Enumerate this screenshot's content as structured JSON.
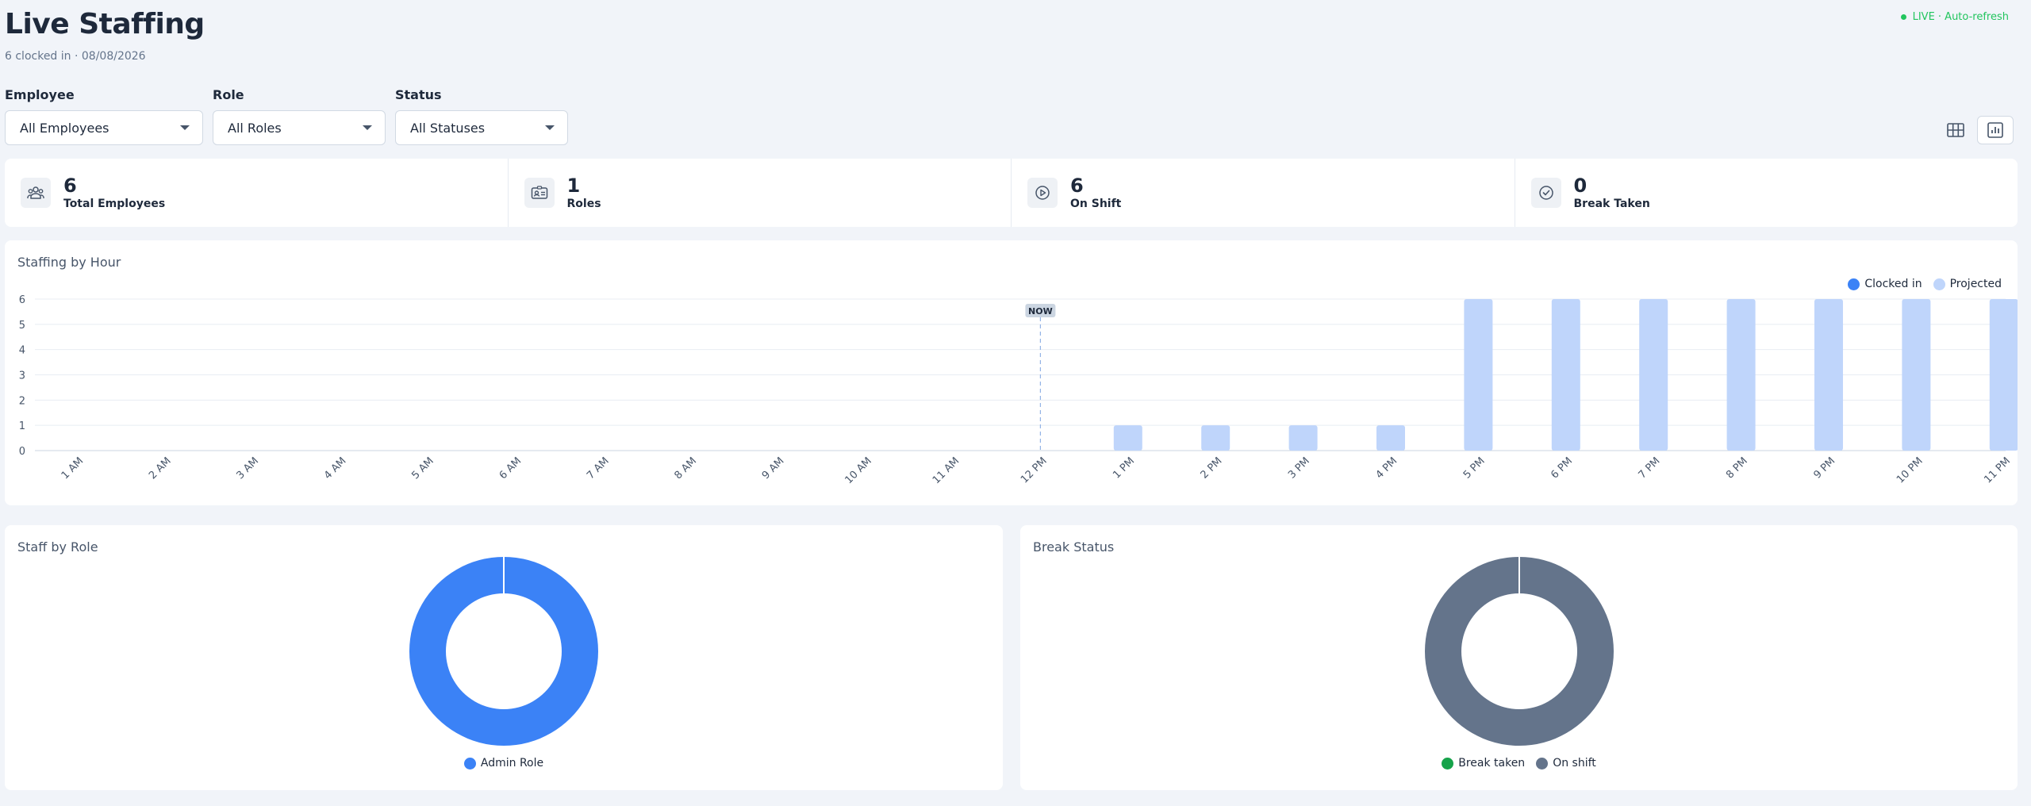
{
  "header": {
    "title": "Live Staffing",
    "subtitle": "6 clocked in · 08/08/2026",
    "live_label": "LIVE · Auto-refresh"
  },
  "filters": [
    {
      "label": "Employee",
      "value": "All Employees"
    },
    {
      "label": "Role",
      "value": "All Roles"
    },
    {
      "label": "Status",
      "value": "All Statuses"
    }
  ],
  "view_toggle": {
    "active": "chart-view",
    "icons": [
      "grid-view-icon",
      "chart-view-icon"
    ]
  },
  "stats": [
    {
      "value": "6",
      "label": "Total Employees",
      "icon": "users-icon"
    },
    {
      "value": "1",
      "label": "Roles",
      "icon": "id-card-icon"
    },
    {
      "value": "6",
      "label": "On Shift",
      "icon": "play-circle-icon"
    },
    {
      "value": "0",
      "label": "Break Taken",
      "icon": "check-circle-icon"
    }
  ],
  "staffing_by_hour": {
    "title": "Staffing by Hour",
    "now_label": "NOW"
  },
  "staff_by_role": {
    "title": "Staff by Role"
  },
  "break_status": {
    "title": "Break Status"
  },
  "colors": {
    "clocked_in": "#3b82f6",
    "projected": "#bfd5fb",
    "admin_role": "#3b82f6",
    "break_taken": "#16a34a",
    "on_shift": "#64748b",
    "live": "#22c55e"
  },
  "chart_data": [
    {
      "type": "bar",
      "title": "Staffing by Hour",
      "categories": [
        "1 AM",
        "2 AM",
        "3 AM",
        "4 AM",
        "5 AM",
        "6 AM",
        "7 AM",
        "8 AM",
        "9 AM",
        "10 AM",
        "11 AM",
        "12 PM",
        "1 PM",
        "2 PM",
        "3 PM",
        "4 PM",
        "5 PM",
        "6 PM",
        "7 PM",
        "8 PM",
        "9 PM",
        "10 PM",
        "11 PM"
      ],
      "series": [
        {
          "name": "Clocked in",
          "values": [
            0,
            0,
            0,
            0,
            0,
            0,
            0,
            0,
            0,
            0,
            0,
            0,
            0,
            0,
            0,
            0,
            0,
            0,
            0,
            0,
            0,
            0,
            0
          ]
        },
        {
          "name": "Projected",
          "values": [
            0,
            0,
            0,
            0,
            0,
            0,
            0,
            0,
            0,
            0,
            0,
            0,
            1,
            1,
            1,
            1,
            6,
            6,
            6,
            6,
            6,
            6,
            6
          ]
        }
      ],
      "ylim": [
        0,
        6
      ],
      "yticks": [
        0,
        1,
        2,
        3,
        4,
        5,
        6
      ],
      "now_category": "12 PM",
      "grid": true,
      "legend": "top-right"
    },
    {
      "type": "pie",
      "title": "Staff by Role",
      "labels": [
        "Admin Role"
      ],
      "values": [
        6
      ],
      "donut": true,
      "legend": "bottom"
    },
    {
      "type": "pie",
      "title": "Break Status",
      "labels": [
        "Break taken",
        "On shift"
      ],
      "values": [
        0,
        6
      ],
      "donut": true,
      "legend": "bottom"
    }
  ]
}
